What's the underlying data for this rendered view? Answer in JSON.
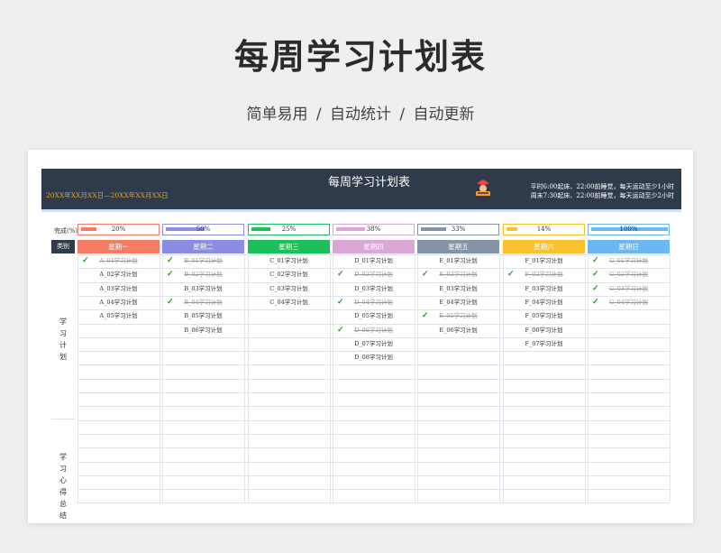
{
  "page": {
    "title": "每周学习计划表",
    "subtitle": "简单易用 / 自动统计 / 自动更新"
  },
  "sheet": {
    "title": "每周学习计划表",
    "date_range": "20XX年XX月XX日—20XX年XX月XX日",
    "note_line1": "平时6:00起床、22:00前睡觉，每天运动至少1小时",
    "note_line2": "周末7:30起床、22:00前睡觉，每天运动至少2小时",
    "progress_label": "完成(%)",
    "category_label": "类别",
    "section_plan": "学习计划",
    "section_summary": "学习心得总结"
  },
  "days": [
    {
      "name": "星期一",
      "color": "#f47c64",
      "border": "#f47c64",
      "progress": 20,
      "pct_label": "20%",
      "tasks": [
        {
          "text": "A_01学习计划",
          "done": true
        },
        {
          "text": "A_02学习计划",
          "done": false
        },
        {
          "text": "A_03学习计划",
          "done": false
        },
        {
          "text": "A_04学习计划",
          "done": false
        },
        {
          "text": "A_05学习计划",
          "done": false
        }
      ]
    },
    {
      "name": "星期二",
      "color": "#8d8de0",
      "border": "#8d8de0",
      "progress": 50,
      "pct_label": "50%",
      "tasks": [
        {
          "text": "B_01学习计划",
          "done": true
        },
        {
          "text": "B_02学习计划",
          "done": true
        },
        {
          "text": "B_03学习计划",
          "done": false
        },
        {
          "text": "B_04学习计划",
          "done": true
        },
        {
          "text": "B_05学习计划",
          "done": false
        },
        {
          "text": "B_06学习计划",
          "done": false
        }
      ]
    },
    {
      "name": "星期三",
      "color": "#1dbf5a",
      "border": "#1dbf5a",
      "progress": 25,
      "pct_label": "25%",
      "tasks": [
        {
          "text": "C_01学习计划",
          "done": false
        },
        {
          "text": "C_02学习计划",
          "done": false
        },
        {
          "text": "C_03学习计划",
          "done": false
        },
        {
          "text": "C_04学习计划",
          "done": false
        }
      ]
    },
    {
      "name": "星期四",
      "color": "#dba7d4",
      "border": "#dba7d4",
      "progress": 38,
      "pct_label": "38%",
      "tasks": [
        {
          "text": "D_01学习计划",
          "done": false
        },
        {
          "text": "D_02学习计划",
          "done": true
        },
        {
          "text": "D_03学习计划",
          "done": false
        },
        {
          "text": "D_04学习计划",
          "done": true
        },
        {
          "text": "D_05学习计划",
          "done": false
        },
        {
          "text": "D_06学习计划",
          "done": true
        },
        {
          "text": "D_07学习计划",
          "done": false
        },
        {
          "text": "D_08学习计划",
          "done": false
        }
      ]
    },
    {
      "name": "星期五",
      "color": "#8593a7",
      "border": "#8593a7",
      "progress": 33,
      "pct_label": "33%",
      "tasks": [
        {
          "text": "E_01学习计划",
          "done": false
        },
        {
          "text": "E_02学习计划",
          "done": true
        },
        {
          "text": "E_03学习计划",
          "done": false
        },
        {
          "text": "E_04学习计划",
          "done": false
        },
        {
          "text": "E_05学习计划",
          "done": true
        },
        {
          "text": "E_06学习计划",
          "done": false
        }
      ]
    },
    {
      "name": "星期六",
      "color": "#f8c22f",
      "border": "#f8c22f",
      "progress": 14,
      "pct_label": "14%",
      "tasks": [
        {
          "text": "F_01学习计划",
          "done": false
        },
        {
          "text": "F_02学习计划",
          "done": true
        },
        {
          "text": "F_03学习计划",
          "done": false
        },
        {
          "text": "F_04学习计划",
          "done": false
        },
        {
          "text": "F_05学习计划",
          "done": false
        },
        {
          "text": "F_06学习计划",
          "done": false
        },
        {
          "text": "F_07学习计划",
          "done": false
        }
      ]
    },
    {
      "name": "星期日",
      "color": "#6bb7f0",
      "border": "#6bb7f0",
      "progress": 100,
      "pct_label": "100%",
      "tasks": [
        {
          "text": "G_01学习计划",
          "done": true
        },
        {
          "text": "G_02学习计划",
          "done": true
        },
        {
          "text": "G_03学习计划",
          "done": true
        },
        {
          "text": "G_04学习计划",
          "done": true
        }
      ]
    }
  ],
  "icons": {
    "done_check": "check-icon",
    "banner_decoration": "cartoon-reader-icon"
  }
}
